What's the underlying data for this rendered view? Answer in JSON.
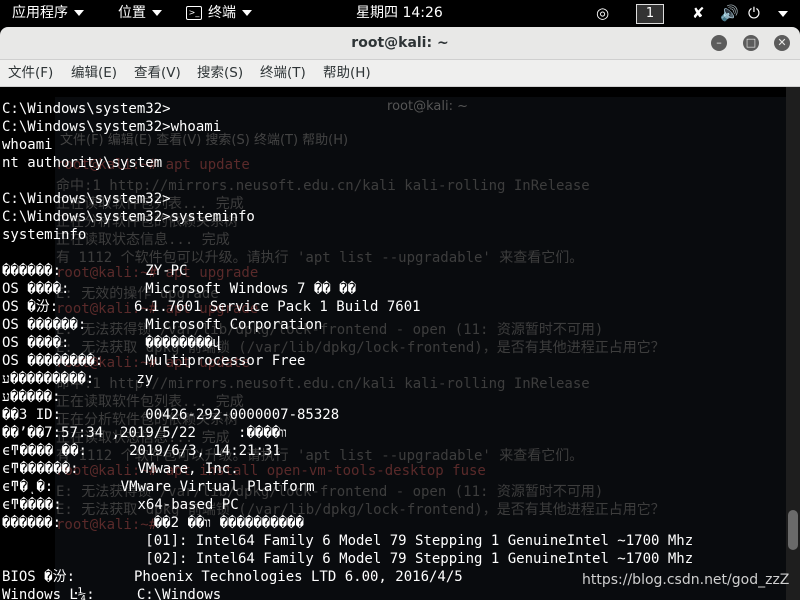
{
  "topbar": {
    "apps_label": "应用程序",
    "places_label": "位置",
    "terminal_label": "终端",
    "clock": "星期四 14:26",
    "workspace": "1"
  },
  "window": {
    "title": "root@kali: ~"
  },
  "menubar": {
    "file": "文件(F)",
    "edit": "编辑(E)",
    "view": "查看(V)",
    "search": "搜索(S)",
    "terminal": "终端(T)",
    "help": "帮助(H)"
  },
  "background_window": {
    "title": "root@kali: ~",
    "menu": "文件(F)  编辑(E)  查看(V)  搜索(S)  终端(T)  帮助(H)",
    "lines": [
      "root@kali:~# apt update",
      "命中:1 http://mirrors.neusoft.edu.cn/kali kali-rolling InRelease",
      "正在读取软件包列表... 完成",
      "正在分析软件包的依赖关系树",
      "正在读取状态信息... 完成",
      "有 1112 个软件包可以升级。请执行 'apt list --upgradable' 来查看它们。",
      "root@kali:~# apt upgrade",
      "E: 无效的操作 upgrade",
      "root@kali:~# apt upgrade",
      "E: 无法获得锁 /var/lib/dpkg/lock-frontend - open (11: 资源暂时不可用)",
      "E: 无法获取 dpkg 前端锁 (/var/lib/dpkg/lock-frontend)，是否有其他进程正占用它？",
      "root@kali:~# apt update",
      "命中:1 http://mirrors.neusoft.edu.cn/kali kali-rolling InRelease",
      "正在读取软件包列表... 完成",
      "正在分析软件包的依赖关系树",
      "正在读取状态信息... 完成",
      "有 1112 个软件包可以升级。请执行 'apt list --upgradable' 来查看它们。",
      "root@kali:~# apt install open-vm-tools-desktop fuse",
      "E: 无法获得锁 /var/lib/dpkg/lock-frontend - open (11: 资源暂时不可用)",
      "E: 无法获取 dpkg 前端锁 (/var/lib/dpkg/lock-frontend)，是否有其他进程正占用它？",
      "root@kali:~# "
    ]
  },
  "terminal": {
    "lines": [
      "C:\\Windows\\system32>",
      "C:\\Windows\\system32>whoami",
      "whoami",
      "nt authority\\system",
      "",
      "C:\\Windows\\system32>",
      "C:\\Windows\\system32>systeminfo",
      "systeminfo",
      "",
      "������:          ZY-PC",
      "OS ����:         Microsoft Windows 7 �� ��",
      "OS �汾:         6.1.7601 Service Pack 1 Build 7601",
      "OS ������:       Microsoft Corporation",
      "OS ����:         ��������վ",
      "OS ��������:     Multiprocessor Free",
      "ע���������:     zy",
      "ע�����:",
      "��3 ID:          00426-292-0000007-85328",
      "��ʼ��װ����:     2019/5/22, 7:57:34",
      "ϵͳ���� ��:     2019/6/3, 14:21:31",
      "ϵͳ������:       VMware, Inc.",
      "ϵͳ�ͺ�:        VMware Virtual Platform",
      "ϵͳ����:         x64-based PC",
      "������:           ��װ�� 2 ����������",
      "                 [01]: Intel64 Family 6 Model 79 Stepping 1 GenuineIntel ~1700 Mhz",
      "                 [02]: Intel64 Family 6 Model 79 Stepping 1 GenuineIntel ~1700 Mhz",
      "BIOS �汾:       Phoenix Technologies LTD 6.00, 2016/4/5",
      "Windows Ŀ¼:     C:\\Windows"
    ]
  },
  "watermark": "https://blog.csdn.net/god_zzZ",
  "icons": {
    "camera": "camera-icon",
    "network": "network-icon",
    "volume": "volume-icon",
    "power": "power-icon"
  },
  "colors": {
    "terminal_bg": "#000000",
    "terminal_fg": "#ffffff",
    "titlebar": "#e8e8e7"
  }
}
